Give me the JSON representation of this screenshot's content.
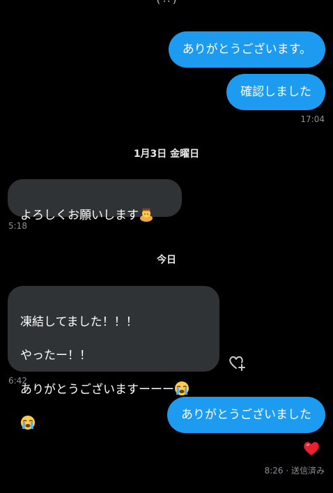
{
  "header": {
    "fragment": "( ∴ )"
  },
  "messages": [
    {
      "text": "ありがとうございます。"
    },
    {
      "text": "確認しました",
      "time": "17:04"
    },
    {
      "date": "1月3日 金曜日"
    },
    {
      "text": "よろしくお願いします",
      "emoji": "person-bowing-emoji",
      "time": "5:18"
    },
    {
      "date": "今日"
    },
    {
      "lines": [
        "凍結してました！！！",
        "やったー！！",
        "ありがとうございますーーー"
      ],
      "emoji": "loudly-crying-emoji",
      "time": "6:42"
    },
    {
      "text": "ありがとうございました",
      "reaction": "red-heart-emoji",
      "time": "8:26",
      "status": "送信済み"
    }
  ],
  "colors": {
    "outgoing_bubble": "#1d9bf0",
    "incoming_bubble": "#2f3336",
    "background": "#000000"
  }
}
